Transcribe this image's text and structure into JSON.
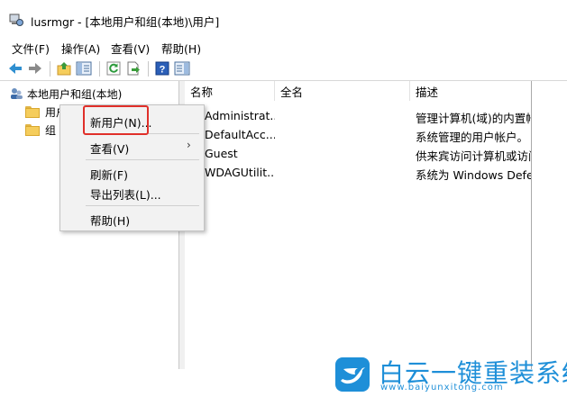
{
  "window": {
    "title": "lusrmgr - [本地用户和组(本地)\\用户]"
  },
  "menubar": {
    "items": [
      "文件(F)",
      "操作(A)",
      "查看(V)",
      "帮助(H)"
    ]
  },
  "toolbar": {
    "icons": [
      "back-arrow-icon",
      "forward-arrow-icon",
      "up-folder-icon",
      "show-tree-icon",
      "refresh-icon",
      "export-list-icon",
      "help-icon",
      "properties-pane-icon"
    ]
  },
  "tree": {
    "root": "本地用户和组(本地)",
    "items": [
      "用户",
      "组"
    ]
  },
  "list": {
    "columns": [
      "名称",
      "全名",
      "描述"
    ],
    "rows": [
      {
        "name": "Administrat...",
        "fullname": "",
        "description": "管理计算机(域)的内置帐"
      },
      {
        "name": "DefaultAcc...",
        "fullname": "",
        "description": "系统管理的用户帐户。"
      },
      {
        "name": "Guest",
        "fullname": "",
        "description": "供来宾访问计算机或访问"
      },
      {
        "name": "WDAGUtilit...",
        "fullname": "",
        "description": "系统为 Windows Defen"
      }
    ]
  },
  "context_menu": {
    "items": [
      "新用户(N)...",
      "查看(V)",
      "刷新(F)",
      "导出列表(L)...",
      "帮助(H)"
    ]
  },
  "watermark": {
    "title": "白云一键重装系统",
    "url": "www.baiyunxitong.com"
  },
  "colors": {
    "highlight_border": "#e0302a",
    "watermark_blue": "#1e8fd8",
    "folder": "#f5cd5c"
  }
}
